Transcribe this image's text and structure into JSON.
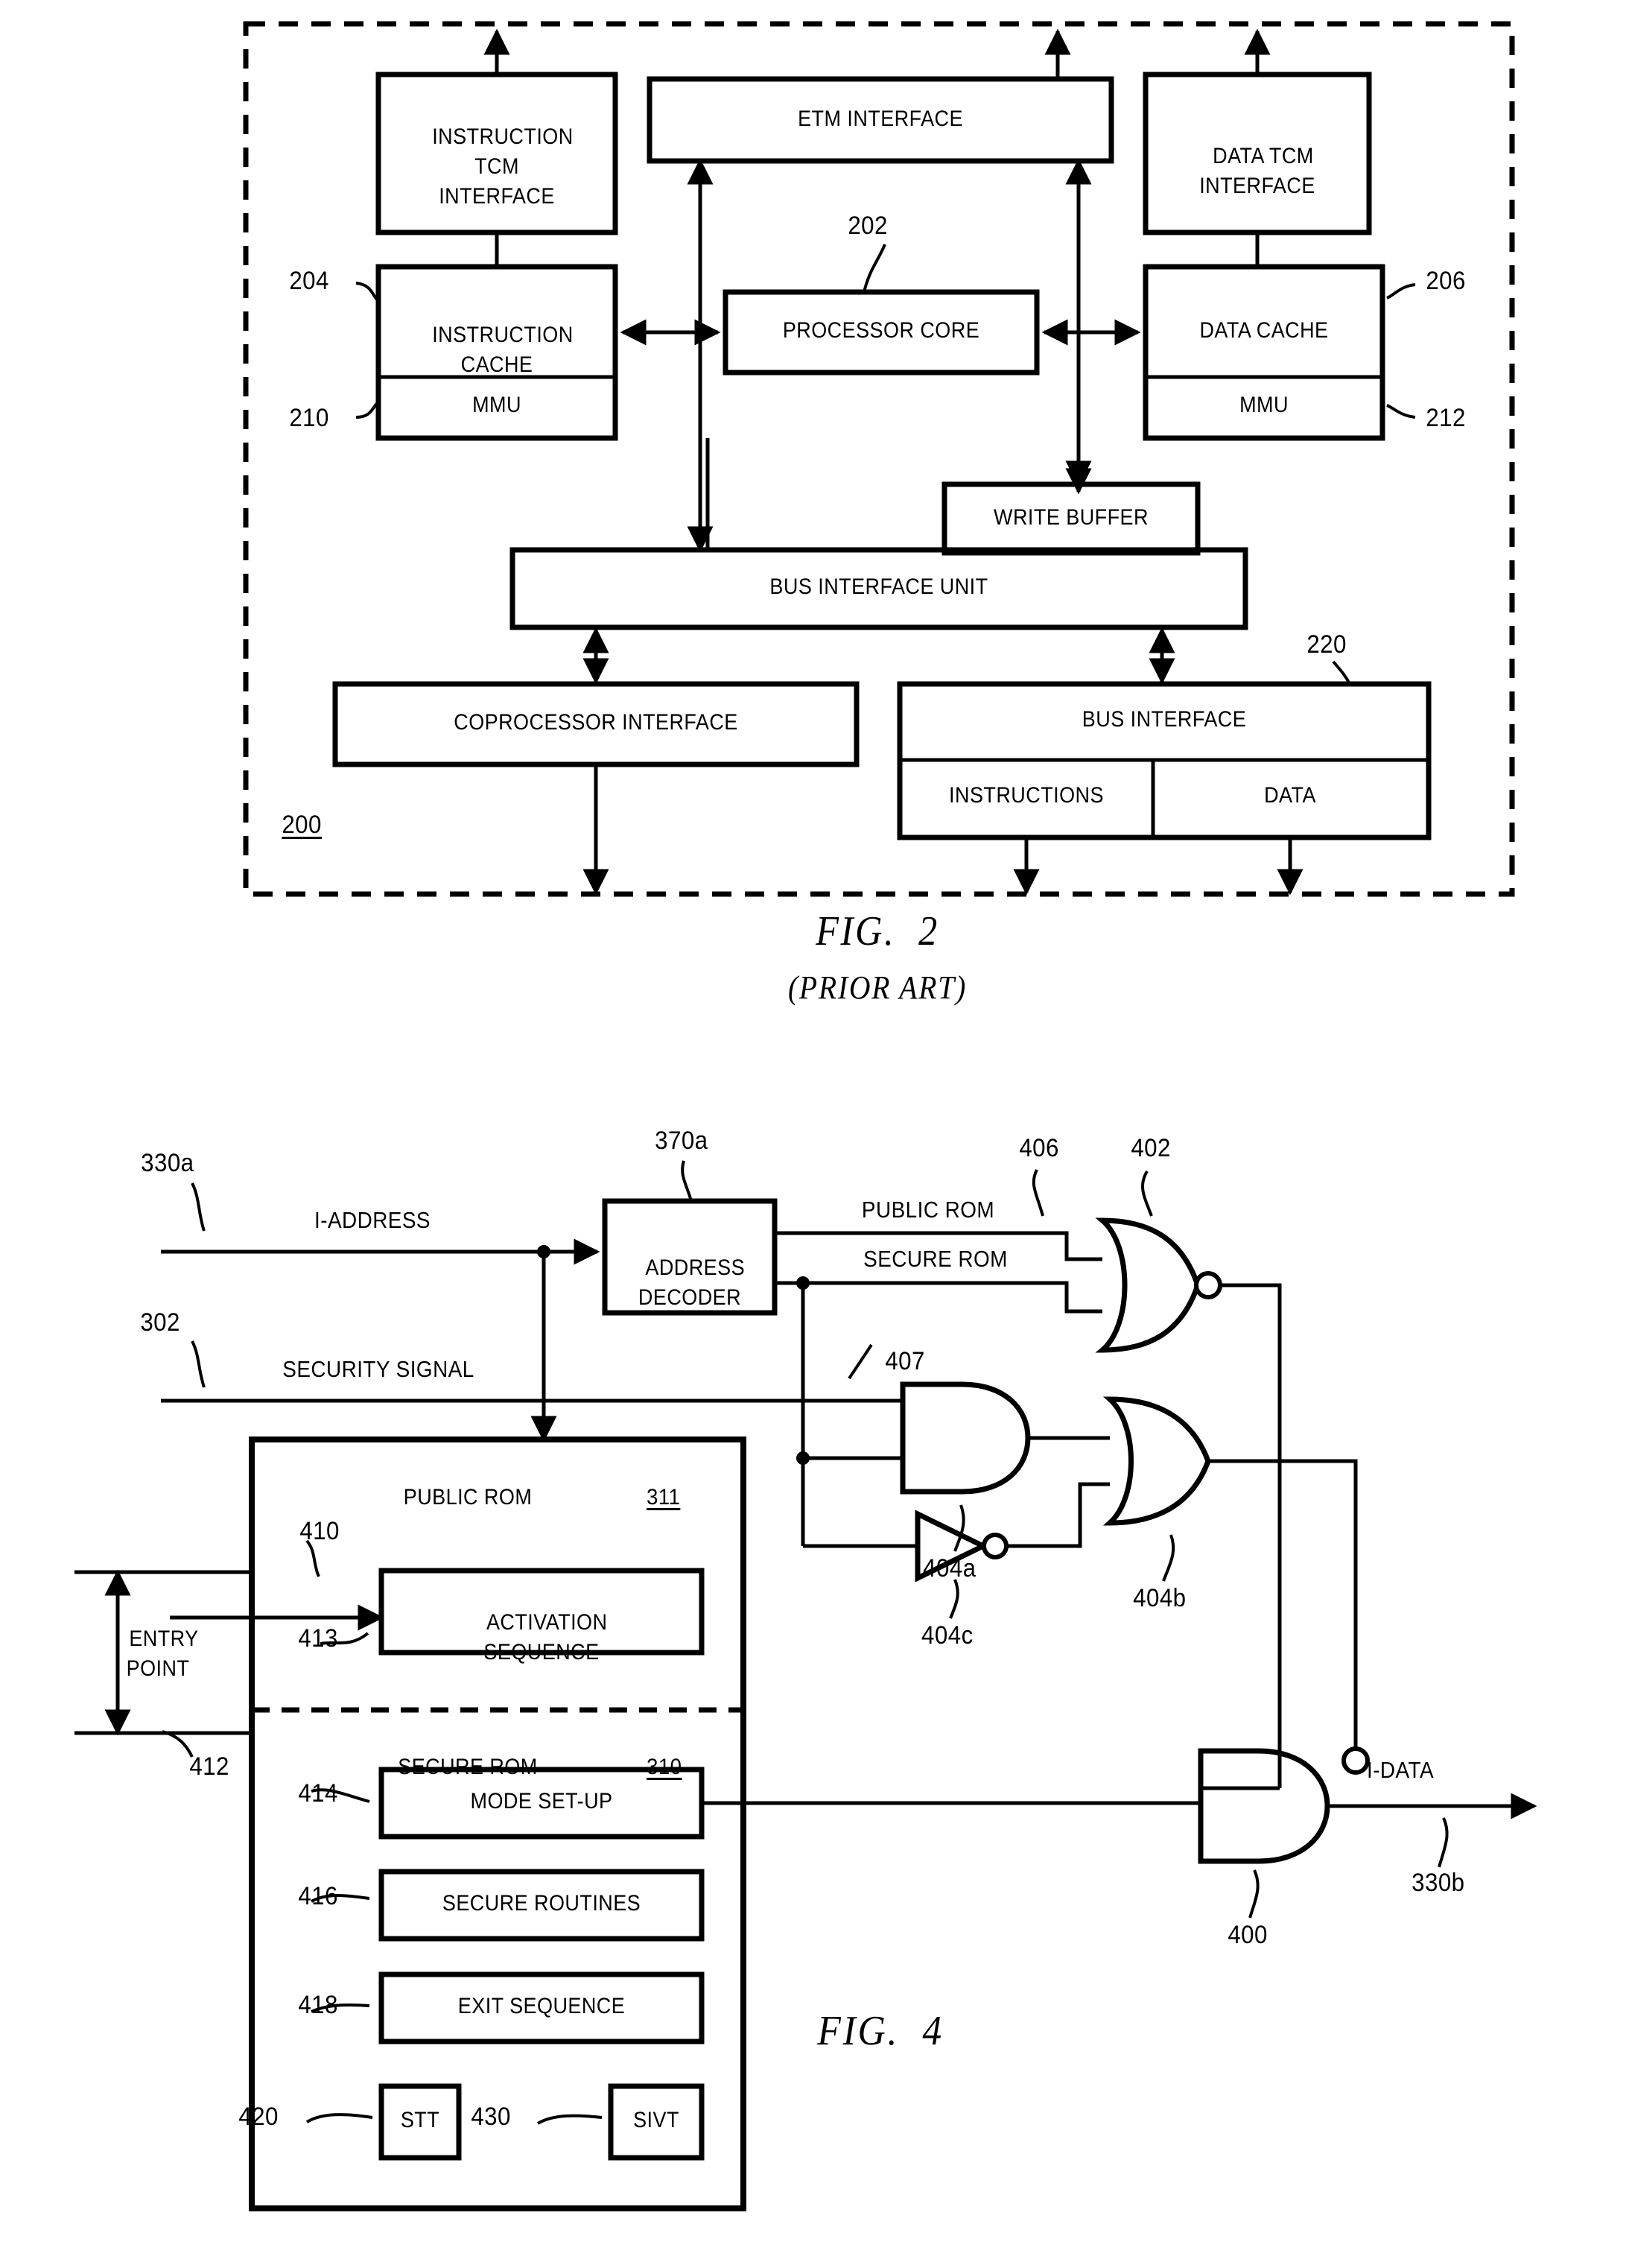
{
  "figure2": {
    "caption": "FIG.  2",
    "caption_sub": "(PRIOR ART)",
    "chip_ref": "200",
    "boxes": {
      "instruction_tcm_interface": "INSTRUCTION\nTCM\nINTERFACE",
      "etm_interface": "ETM INTERFACE",
      "data_tcm_interface": "DATA TCM\nINTERFACE",
      "instruction_cache": "INSTRUCTION\nCACHE",
      "processor_core": "PROCESSOR CORE",
      "data_cache": "DATA CACHE",
      "mmu_left": "MMU",
      "mmu_right": "MMU",
      "write_buffer": "WRITE BUFFER",
      "bus_interface_unit": "BUS INTERFACE UNIT",
      "coprocessor_interface": "COPROCESSOR INTERFACE",
      "bus_interface": "BUS INTERFACE",
      "instructions": "INSTRUCTIONS",
      "data": "DATA"
    },
    "refs": {
      "processor_core": "202",
      "instruction_cache": "204",
      "data_cache": "206",
      "mmu_left": "210",
      "mmu_right": "212",
      "bus_interface": "220"
    }
  },
  "figure4": {
    "caption": "FIG.  4",
    "signals": {
      "i_address": "I-ADDRESS",
      "security_signal": "SECURITY SIGNAL",
      "public_rom_line": "PUBLIC ROM",
      "secure_rom_line": "SECURE ROM",
      "i_data": "I-DATA"
    },
    "boxes": {
      "address_decoder": "ADDRESS\nDECODER",
      "public_rom": "PUBLIC ROM",
      "secure_rom": "SECURE ROM",
      "activation_sequence": "ACTIVATION\nSEQUENCE",
      "mode_setup": "MODE SET-UP",
      "secure_routines": "SECURE ROUTINES",
      "exit_sequence": "EXIT SEQUENCE",
      "stt": "STT",
      "sivt": "SIVT"
    },
    "labels": {
      "entry_point": "ENTRY\nPOINT"
    },
    "refs": {
      "i_address_in": "330a",
      "address_decoder": "370a",
      "public_rom_line": "406",
      "nor_gate": "402",
      "security_signal": "302",
      "secure_rom_line": "407",
      "and_gate": "404a",
      "or_gate": "404b",
      "inverter": "404c",
      "public_rom_block": "311",
      "secure_rom_block": "310",
      "entry_point_arrow": "410",
      "activation_sequence": "413",
      "entry_range": "412",
      "mode_setup": "414",
      "secure_routines": "416",
      "exit_sequence": "418",
      "stt": "420",
      "sivt": "430",
      "nand_gate": "400",
      "i_data_out": "330b"
    }
  },
  "colors": {
    "ink": "#000000",
    "paper": "#ffffff"
  }
}
